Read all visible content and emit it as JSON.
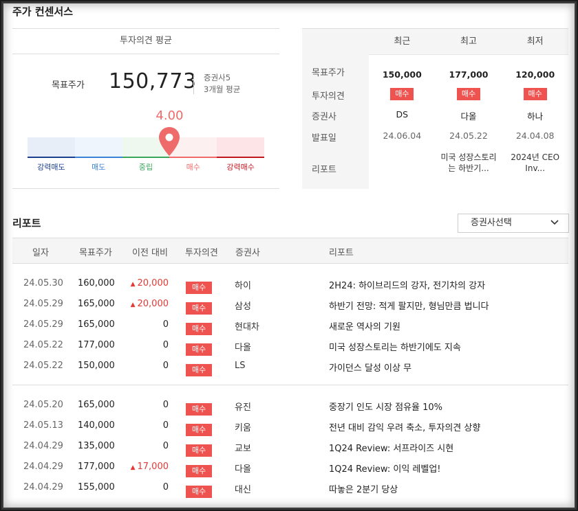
{
  "page_title": "주가 컨센서스",
  "consensus": {
    "header": "투자의견 평균",
    "target_label": "목표주가",
    "target_value": "150,773",
    "broker_count": "증권사5",
    "period": "3개월 평균",
    "score": "4.00",
    "score_fraction": 0.6,
    "scale": [
      {
        "label": "강력매도",
        "color": "#e8eef7",
        "line": "#1a3e8c",
        "text": "#1a3e8c"
      },
      {
        "label": "매도",
        "color": "#eef5fd",
        "line": "#3b82d6",
        "text": "#3b82d6"
      },
      {
        "label": "중립",
        "color": "#eef8ef",
        "line": "#3aa65a",
        "text": "#3aa65a"
      },
      {
        "label": "매수",
        "color": "#fdf0f0",
        "line": "#ef6a6a",
        "text": "#ef6a6a"
      },
      {
        "label": "강력매수",
        "color": "#fde4e6",
        "line": "#c0141f",
        "text": "#c0141f"
      }
    ]
  },
  "recent": {
    "columns": [
      "최근",
      "최고",
      "최저"
    ],
    "row_labels": {
      "price": "목표주가",
      "opinion": "투자의견",
      "broker": "증권사",
      "date": "발표일",
      "report": "리포트"
    },
    "prices": [
      "150,000",
      "177,000",
      "120,000"
    ],
    "opinions": [
      "매수",
      "매수",
      "매수"
    ],
    "brokers": [
      "DS",
      "다올",
      "하나"
    ],
    "dates": [
      "24.06.04",
      "24.05.22",
      "24.04.08"
    ],
    "reports": [
      "",
      "미국 성장스토리는 하반기...",
      "2024년 CEO Inv..."
    ]
  },
  "reports": {
    "title": "리포트",
    "select_label": "증권사선택",
    "headers": [
      "일자",
      "목표주가",
      "이전 대비",
      "투자의견",
      "증권사",
      "리포트"
    ],
    "rows": [
      {
        "date": "24.05.30",
        "price": "160,000",
        "diff": "20,000",
        "up": true,
        "op": "매수",
        "broker": "하이",
        "title": "2H24: 하이브리드의 강자, 전기차의 강자"
      },
      {
        "date": "24.05.29",
        "price": "165,000",
        "diff": "20,000",
        "up": true,
        "op": "매수",
        "broker": "삼성",
        "title": "하반기 전망: 적게 팔지만, 형님만큼 법니다"
      },
      {
        "date": "24.05.29",
        "price": "165,000",
        "diff": "0",
        "up": false,
        "op": "매수",
        "broker": "현대차",
        "title": "새로운 역사의 기원"
      },
      {
        "date": "24.05.22",
        "price": "177,000",
        "diff": "0",
        "up": false,
        "op": "매수",
        "broker": "다올",
        "title": "미국 성장스토리는 하반기에도 지속"
      },
      {
        "date": "24.05.22",
        "price": "150,000",
        "diff": "0",
        "up": false,
        "op": "매수",
        "broker": "LS",
        "title": "가이던스 달성 이상 무"
      },
      {
        "date": "24.05.20",
        "price": "165,000",
        "diff": "0",
        "up": false,
        "op": "매수",
        "broker": "유진",
        "title": "중장기 인도 시장 점유율 10%"
      },
      {
        "date": "24.05.13",
        "price": "140,000",
        "diff": "0",
        "up": false,
        "op": "매수",
        "broker": "키움",
        "title": "전년 대비 감익 우려 축소, 투자의견 상향"
      },
      {
        "date": "24.04.29",
        "price": "135,000",
        "diff": "0",
        "up": false,
        "op": "매수",
        "broker": "교보",
        "title": "1Q24 Review: 서프라이즈 시현"
      },
      {
        "date": "24.04.29",
        "price": "177,000",
        "diff": "17,000",
        "up": true,
        "op": "매수",
        "broker": "다올",
        "title": "1Q24 Review: 이익 레벨업!"
      },
      {
        "date": "24.04.29",
        "price": "155,000",
        "diff": "0",
        "up": false,
        "op": "매수",
        "broker": "대신",
        "title": "따놓은 2분기 당상"
      }
    ]
  }
}
